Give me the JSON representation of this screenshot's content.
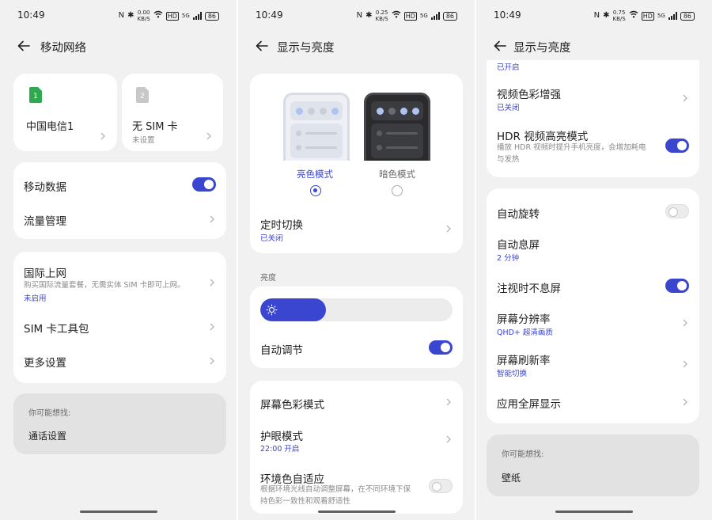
{
  "status": {
    "time": "10:49",
    "nfc": "N",
    "bluetooth": "✱",
    "speed1": "0.00",
    "speed1_unit": "KB/S",
    "speed2": "0.25",
    "speed2_unit": "KB/S",
    "speed3": "0.75",
    "speed3_unit": "KB/S",
    "hd": "HD",
    "net": "5G",
    "battery": "86"
  },
  "colors": {
    "accent": "#3a45d0",
    "sim1": "#2fa84f",
    "sim2": "#c8c8c8"
  },
  "icons": {
    "back": "arrow-left-icon",
    "chevron": "chevron-right-icon",
    "sun": "sun-icon"
  },
  "panel1": {
    "title": "移动网络",
    "sim1": {
      "number": "1",
      "name": "中国电信1"
    },
    "sim2": {
      "number": "2",
      "name": "无 SIM 卡",
      "sub": "未设置"
    },
    "mobile_data": {
      "label": "移动数据",
      "on": true
    },
    "traffic": "流量管理",
    "roaming": {
      "label": "国际上网",
      "desc": "购买国际流量套餐，无需实体 SIM 卡即可上网。",
      "status": "未启用"
    },
    "sim_toolkit": "SIM 卡工具包",
    "more": "更多设置",
    "suggest": {
      "head": "你可能想找:",
      "item": "通话设置"
    }
  },
  "panel2": {
    "title": "显示与亮度",
    "light_mode": "亮色模式",
    "dark_mode": "暗色模式",
    "selected_mode": "亮色模式",
    "schedule": {
      "label": "定时切换",
      "status": "已关闭"
    },
    "brightness_section": "亮度",
    "brightness_level": 0.34,
    "auto_adjust": {
      "label": "自动调节",
      "on": true
    },
    "color_mode": "屏幕色彩模式",
    "eye_care": {
      "label": "护眼模式",
      "status": "22:00 开启"
    },
    "ambient": {
      "label": "环境色自适应",
      "desc1": "根据环境光线自动调整屏幕，在不同环境下保",
      "desc2": "持色彩一致性和观看舒适性",
      "on": false
    }
  },
  "panel3": {
    "title": "显示与亮度",
    "prev_status": "已开启",
    "video_color": {
      "label": "视频色彩增强",
      "status": "已关闭"
    },
    "hdr": {
      "label": "HDR 视频高亮模式",
      "desc1": "播放 HDR 视频时提升手机亮度，会增加耗电",
      "desc2": "与发热",
      "on": true
    },
    "auto_rotate": {
      "label": "自动旋转",
      "on": false
    },
    "screen_timeout": {
      "label": "自动息屏",
      "status": "2 分钟"
    },
    "attention": {
      "label": "注视时不息屏",
      "on": true
    },
    "resolution": {
      "label": "屏幕分辨率",
      "status": "QHD+ 超清画质"
    },
    "refresh": {
      "label": "屏幕刷新率",
      "status": "智能切换"
    },
    "fullscreen": "应用全屏显示",
    "suggest": {
      "head": "你可能想找:",
      "item": "壁纸"
    }
  }
}
